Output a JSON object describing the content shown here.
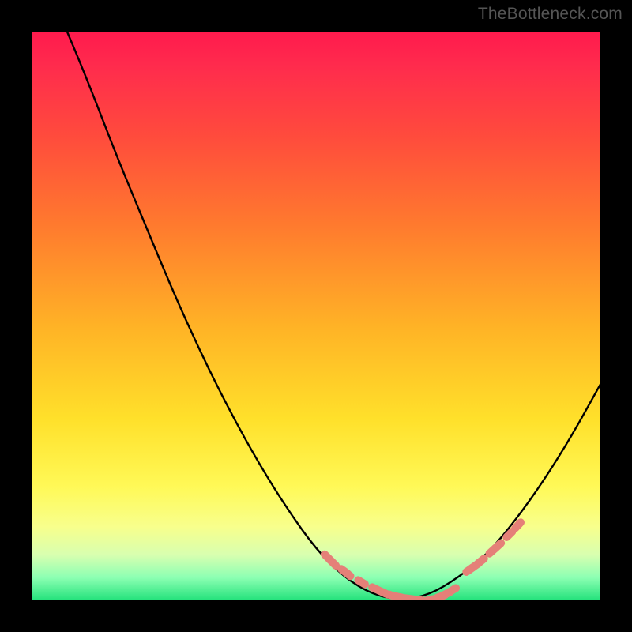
{
  "watermark": "TheBottleneck.com",
  "chart_data": {
    "type": "line",
    "title": "",
    "xlabel": "",
    "ylabel": "",
    "xlim": [
      0,
      1
    ],
    "ylim": [
      0,
      1
    ],
    "series": [
      {
        "name": "bottleneck-curve",
        "x": [
          0.0,
          0.05,
          0.1,
          0.15,
          0.2,
          0.25,
          0.3,
          0.35,
          0.4,
          0.45,
          0.5,
          0.55,
          0.6,
          0.65,
          0.7,
          0.75,
          0.8,
          0.85,
          0.9,
          0.95,
          1.0
        ],
        "values": [
          1.14,
          1.03,
          0.91,
          0.78,
          0.66,
          0.54,
          0.43,
          0.33,
          0.24,
          0.16,
          0.09,
          0.04,
          0.01,
          0.0,
          0.01,
          0.04,
          0.08,
          0.14,
          0.21,
          0.29,
          0.38
        ]
      },
      {
        "name": "left-highlight-band",
        "x": [
          0.52,
          0.53,
          0.55,
          0.555,
          0.58,
          0.605,
          0.62,
          0.635,
          0.645
        ],
        "values": [
          0.076,
          0.066,
          0.051,
          0.047,
          0.032,
          0.02,
          0.013,
          0.008,
          0.006
        ]
      },
      {
        "name": "right-highlight-band",
        "x": [
          0.77,
          0.78,
          0.79,
          0.81,
          0.82,
          0.84,
          0.855
        ],
        "values": [
          0.054,
          0.061,
          0.069,
          0.087,
          0.096,
          0.116,
          0.132
        ]
      },
      {
        "name": "bottom-highlight-cluster",
        "x": [
          0.655,
          0.67,
          0.685,
          0.705,
          0.72,
          0.73,
          0.74
        ],
        "values": [
          0.004,
          0.002,
          0.0,
          0.002,
          0.007,
          0.012,
          0.018
        ]
      }
    ],
    "highlight_color": "#e58078",
    "curve_color": "#000000",
    "background_gradient": [
      "#ff1a4d",
      "#ff7a2e",
      "#ffe02a",
      "#f8ff8c",
      "#23e27b"
    ]
  }
}
